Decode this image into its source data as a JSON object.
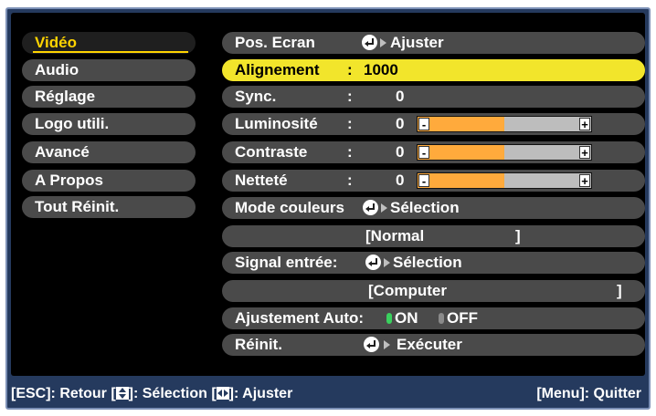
{
  "sidebar": {
    "items": [
      {
        "label": "Vidéo"
      },
      {
        "label": "Audio"
      },
      {
        "label": "Réglage"
      },
      {
        "label": "Logo utili."
      },
      {
        "label": "Avancé"
      },
      {
        "label": "A Propos"
      },
      {
        "label": "Tout Réinit."
      }
    ]
  },
  "rows": {
    "pos_ecran": {
      "label": "Pos. Ecran",
      "action": "Ajuster"
    },
    "alignement": {
      "label": "Alignement",
      "colon": ":",
      "value": "1000"
    },
    "sync": {
      "label": "Sync.",
      "colon": ":",
      "value": "0"
    },
    "luminosite": {
      "label": "Luminosité",
      "colon": ":",
      "value": "0",
      "level_fraction": 0.5
    },
    "contraste": {
      "label": "Contraste",
      "colon": ":",
      "value": "0",
      "level_fraction": 0.5
    },
    "nettete": {
      "label": "Netteté",
      "colon": ":",
      "value": "0",
      "level_fraction": 0.5
    },
    "mode_couleurs": {
      "label": "Mode couleurs",
      "action": "Sélection",
      "value": "[Normal",
      "bracket": "]"
    },
    "signal_entree": {
      "label": "Signal entrée:",
      "action": "Sélection",
      "value": "[Computer",
      "bracket": "]"
    },
    "ajustement_auto": {
      "label": "Ajustement Auto:",
      "on": "ON",
      "off": "OFF"
    },
    "reinit": {
      "label": "Réinit.",
      "action": "Exécuter"
    }
  },
  "slider": {
    "minus": "-",
    "plus": "+"
  },
  "footer": {
    "esc": "[ESC]: Retour [",
    "select": "]: Sélection [",
    "adjust": "]: Ajuster",
    "quit": "[Menu]: Quitter"
  },
  "colors": {
    "frame": "#253a5e",
    "highlight": "#f2e52b",
    "active_text": "#ffd400",
    "bar_fill": "#ffaa3c",
    "on_indicator": "#3ad15e"
  }
}
